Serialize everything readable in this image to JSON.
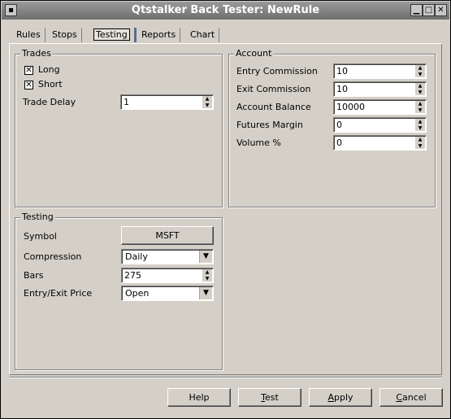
{
  "window": {
    "title": "Qtstalker Back Tester: NewRule",
    "menu_glyph": "▪",
    "min_glyph": "▁",
    "max_glyph": "□",
    "close_glyph": "✕"
  },
  "tabs": [
    {
      "label": "Rules",
      "active": false
    },
    {
      "label": "Stops",
      "active": false
    },
    {
      "label": "Testing",
      "active": true
    },
    {
      "label": "Reports",
      "active": false
    },
    {
      "label": "Chart",
      "active": false
    }
  ],
  "trades": {
    "legend": "Trades",
    "long_label": "Long",
    "long_checked": true,
    "short_label": "Short",
    "short_checked": true,
    "check_glyph": "✕",
    "trade_delay_label": "Trade Delay",
    "trade_delay_value": "1"
  },
  "account": {
    "legend": "Account",
    "fields": [
      {
        "label": "Entry Commission",
        "value": "10"
      },
      {
        "label": "Exit Commission",
        "value": "10"
      },
      {
        "label": "Account Balance",
        "value": "10000"
      },
      {
        "label": "Futures Margin",
        "value": "0"
      },
      {
        "label": "Volume %",
        "value": "0"
      }
    ]
  },
  "testing": {
    "legend": "Testing",
    "symbol_label": "Symbol",
    "symbol_value": "MSFT",
    "compression_label": "Compression",
    "compression_value": "Daily",
    "bars_label": "Bars",
    "bars_value": "275",
    "price_label": "Entry/Exit Price",
    "price_value": "Open"
  },
  "spin_glyphs": {
    "up": "▲",
    "down": "▼"
  },
  "drop_glyph": "▼",
  "buttons": {
    "help": "Help",
    "test_first": "T",
    "test_rest": "est",
    "apply_first": "A",
    "apply_rest": "pply",
    "cancel_first": "C",
    "cancel_rest": "ancel"
  }
}
